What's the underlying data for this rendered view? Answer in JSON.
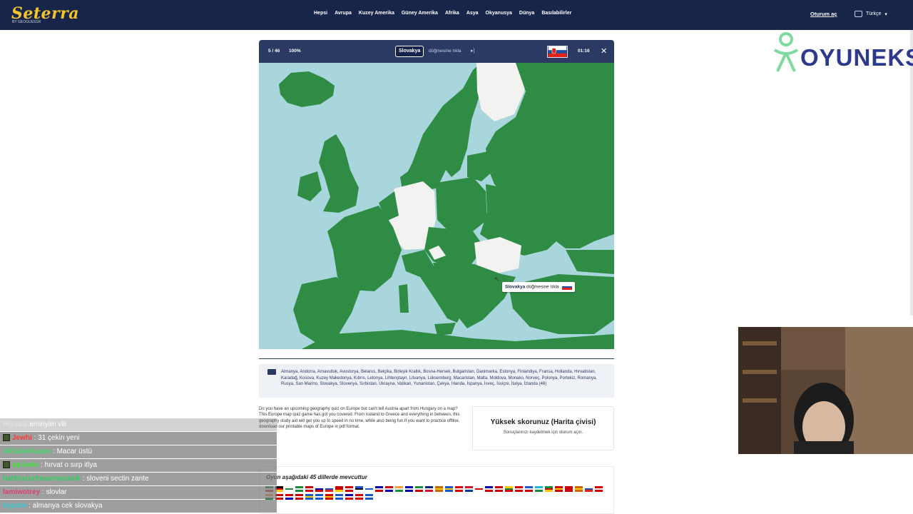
{
  "site": {
    "logo": "Seterra",
    "logo_sub": "BY GEOGUESSR",
    "nav": [
      "Hepsi",
      "Avrupa",
      "Kuzey Amerika",
      "Güney Amerika",
      "Afrika",
      "Asya",
      "Okyanusya",
      "Dünya",
      "Basılabilirler"
    ],
    "login": "Oturum aç",
    "language": "Türkçe"
  },
  "game": {
    "score": "5 / 46",
    "percent": "100%",
    "target": "Slovakya",
    "prompt": "düğmesine tıkla",
    "timer": "01:16",
    "tooltip_target": "Slovakya",
    "tooltip_prompt": "düğmesine tıkla"
  },
  "countries_list": "Almanya, Andorra, Arnavutluk, Avusturya, Belarus, Belçika, Birleşik Krallık, Bosna-Hersek, Bulgaristan, Danimarka, Estonya, Finlandiya, Fransa, Hollanda, Hırvatistan, Karadağ, Kosova, Kuzey Makedonya, Kıbrıs, Letonya, Lihtenştayn, Litvanya, Lüksemburg, Macaristan, Malta, Moldova, Monako, Norveç, Polonya, Portekiz, Romanya, Rusya, San Marino, Slovakya, Slovenya, Sırbistan, Ukrayna, Vatikan, Yunanistan, Çekya, İrlanda, İspanya, İsveç, İsviçre, İtalya, İzlanda (46)",
  "description": "Do you have an upcoming geography quiz on Europe but can't tell Austria apart from Hungary on a map? This Europe map quiz game has got you covered. From Iceland to Greece and everything in between, this geography study aid will get you up to speed in no time, while also being fun.If you want to practice offline, download our printable maps of Europe in pdf format.",
  "highscore": {
    "title": "Yüksek skorunuz (Harita çivisi)",
    "subtitle": "Sonuçlarınızı kaydetmek için oturum açın."
  },
  "languages": {
    "title": "Oyun aşağıdaki 45 dillerde mevcuttur"
  },
  "sponsor": "OYUNEKS",
  "chat": [
    {
      "user": "bigsasi",
      "text": "eminyim vili",
      "faded": true,
      "color": "#bbbbbb"
    },
    {
      "user": "Jewhi",
      "text": ": 31 çekin yeni",
      "color": "#ff3b3b"
    },
    {
      "user": "AkSalurKazan",
      "text": ": Macar üstü",
      "color": "#3ddb6a"
    },
    {
      "user": "op1xele",
      "text": ": hırvat o sırp itlya",
      "color": "#39e639"
    },
    {
      "user": "barbiozurbeaumozanik",
      "text": ": sloveni sectin zante",
      "color": "#2fd05f"
    },
    {
      "user": "lamiwotrey",
      "text": ": slovlar",
      "color": "#d94070"
    },
    {
      "user": "bigram",
      "text": ": almanya cek slovakya",
      "color": "#37c8d4"
    }
  ],
  "colors": {
    "navy": "#17254a",
    "sea": "#a9d6dc",
    "land": "#2f8c45",
    "done": "#f2f2f0"
  }
}
